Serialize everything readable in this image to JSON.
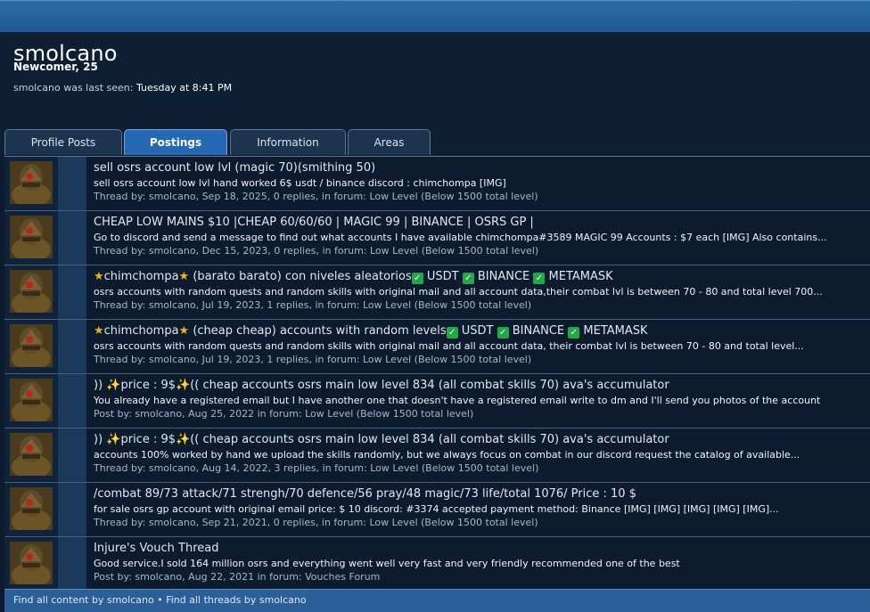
{
  "profile": {
    "username": "smolcano",
    "title": "Newcomer, 25",
    "last_seen_label": "smolcano was last seen:",
    "last_seen_value": "Tuesday at 8:41 PM"
  },
  "tabs": [
    {
      "label": "Profile Posts",
      "active": false
    },
    {
      "label": "Postings",
      "active": true
    },
    {
      "label": "Information",
      "active": false
    },
    {
      "label": "Areas",
      "active": false
    }
  ],
  "posts": [
    {
      "title": "sell osrs account low lvl (magic 70)(smithing 50)",
      "snippet": "sell osrs account low lvl hand worked 6$ usdt / binance discord : chimchompa [IMG]",
      "meta": "Thread by: smolcano, Sep 18, 2025, 0 replies, in forum: Low Level (Below 1500 total level)"
    },
    {
      "title": "CHEAP LOW MAINS $10 |CHEAP 60/60/60 | MAGIC 99 | BINANCE | OSRS GP |",
      "snippet": "Go to discord and send a message to find out what accounts I have available chimchompa#3589 MAGIC 99 Accounts : $7 each [IMG] Also contains...",
      "meta": "Thread by: smolcano, Dec 15, 2023, 0 replies, in forum: Low Level (Below 1500 total level)"
    },
    {
      "title_parts": [
        "★",
        "chimchompa",
        "★",
        " (barato barato) con niveles aleatorios",
        "USDT",
        "BINANCE",
        "METAMASK"
      ],
      "snippet": "osrs accounts with random quests and random skills with original mail and all account data,their combat lvl is between 70 - 80 and total level 700...",
      "meta": "Thread by: smolcano, Jul 19, 2023, 1 replies, in forum: Low Level (Below 1500 total level)"
    },
    {
      "title_parts": [
        "★",
        "chimchompa",
        "★",
        " (cheap cheap) accounts with random levels",
        "USDT",
        "BINANCE",
        "METAMASK"
      ],
      "snippet": "osrs accounts with random quests and random skills with original mail and all account data, their combat lvl is between 70 - 80 and total level...",
      "meta": "Thread by: smolcano, Jul 19, 2023, 1 replies, in forum: Low Level (Below 1500 total level)"
    },
    {
      "title_parts": [
        ")) ",
        "✨",
        "price : 9$",
        "✨",
        "(( cheap accounts osrs main low level 834 (all combat skills 70) ava's accumulator"
      ],
      "snippet": "You already have a registered email but I have another one that doesn't have a registered email write to dm and I'll send you photos of the account",
      "meta": "Post by: smolcano, Aug 25, 2022 in forum: Low Level (Below 1500 total level)"
    },
    {
      "title_parts": [
        ")) ",
        "✨",
        "price : 9$",
        "✨",
        "(( cheap accounts osrs main low level 834 (all combat skills 70) ava's accumulator"
      ],
      "snippet": "accounts 100% worked by hand we upload the skills randomly, but we always focus on combat in our discord request the catalog of available...",
      "meta": "Thread by: smolcano, Aug 14, 2022, 3 replies, in forum: Low Level (Below 1500 total level)"
    },
    {
      "title": "/combat 89/73 attack/71 strengh/70 defence/56 pray/48 magic/73 life/total 1076/ Price : 10 $",
      "snippet": "for sale osrs gp account with original email price: $ 10 discord: #3374 accepted payment method: Binance [IMG] [IMG] [IMG] [IMG] [IMG]...",
      "meta": "Thread by: smolcano, Sep 21, 2021, 0 replies, in forum: Low Level (Below 1500 total level)"
    },
    {
      "title": "Injure's Vouch Thread",
      "snippet": "Good service.I sold 164 million osrs and everything went well very fast and very friendly recommended one of the best",
      "meta": "Post by: smolcano, Aug 22, 2021 in forum: Vouches Forum"
    }
  ],
  "footer": {
    "link1": "Find all content by smolcano",
    "separator": "•",
    "link2": "Find all threads by smolcano"
  },
  "colors": {
    "background": "#0d1b2e",
    "active_tab": "#2568b3",
    "topbar": "#2c6ca5",
    "check": "#22a845",
    "star": "#f4b400"
  },
  "icons": [
    "avatar",
    "star-icon",
    "sparkles-icon",
    "check-mark-icon"
  ]
}
